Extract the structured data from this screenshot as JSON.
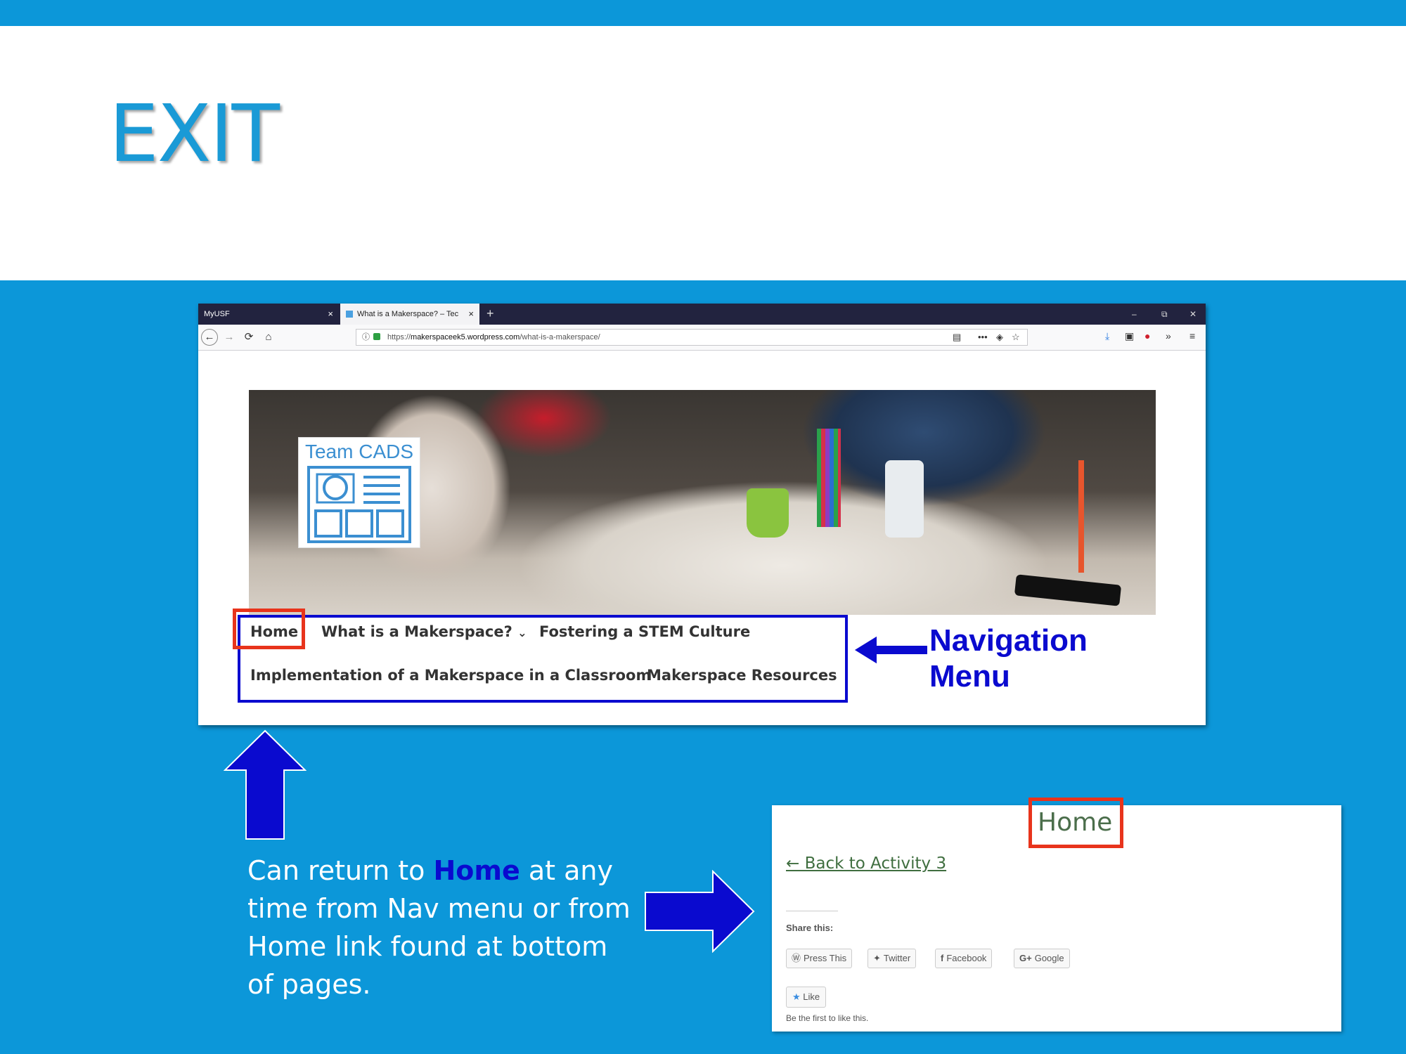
{
  "slide": {
    "title": "EXIT",
    "caption_before": "Can return to ",
    "caption_highlight": "Home",
    "caption_after": " at any time from Nav menu or from Home link found at bottom of pages.",
    "nav_label_line1": "Navigation",
    "nav_label_line2": "Menu"
  },
  "browser": {
    "tabs": [
      {
        "label": "MyUSF",
        "close": "×"
      },
      {
        "label": "What is a Makerspace? – Tec",
        "close": "×"
      }
    ],
    "new_tab": "+",
    "window_controls": [
      "–",
      "⧉",
      "✕"
    ],
    "url_prefix": "https://",
    "url_domain": "makerspaceek5.wordpress.com",
    "url_path": "/what-is-a-makerspace/"
  },
  "site": {
    "logo_text": "Team CADS",
    "nav": {
      "home": "Home",
      "what": "What is a Makerspace?",
      "what_chevron": "⌄",
      "fostering": "Fostering a STEM Culture",
      "implementation": "Implementation of a Makerspace in a Classroom",
      "resources": "Makerspace Resources"
    }
  },
  "panel": {
    "title": "Home",
    "back_link": "← Back to Activity 3",
    "share_label": "Share this:",
    "share_buttons": [
      "Press This",
      "Twitter",
      "Facebook",
      "Google"
    ],
    "like_button": "Like",
    "first_like": "Be the first to like this."
  },
  "colors": {
    "slide_blue": "#0c97d9",
    "annotation_blue": "#0a0acf",
    "highlight_red": "#e8341c"
  }
}
